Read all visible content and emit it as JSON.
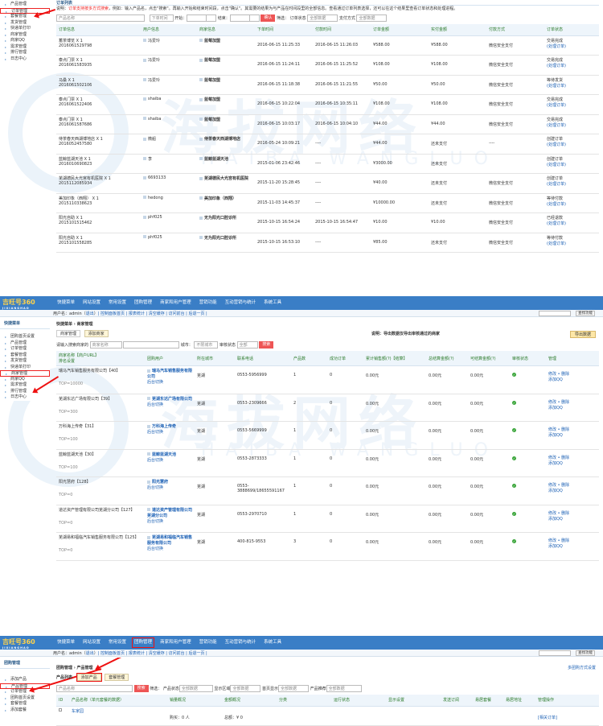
{
  "panel1": {
    "sidebar": [
      "产品管理",
      "订单管理",
      "套餐管理",
      "发货管理",
      "快递单打印",
      "商家管理",
      "商家QQ",
      "需求管理",
      "排行管理",
      "日志中心"
    ],
    "sidebar_selected": 1,
    "section_title": "订单列表",
    "notice_label": "说明：",
    "notice": "订单支持按多方式搜索",
    "notice_rest": "，例如：输入产品名，点击\"搜索\"。再输入开始和结束时间段，点击\"确认\"。其需要的结果为与产品在时间段里的全部信息。查看通过订单列表选择，还可以在这个结果里查看订单状态和处理进程。",
    "filter": {
      "product_placeholder": "产品名称",
      "order_time": "下单时间",
      "start": "开始：",
      "end": "结束：",
      "confirm": "确认",
      "filter_label": "筛选：",
      "status_label": "订单状态",
      "status_value": "全部数据",
      "pay_label": "支付方式",
      "pay_value": "全部数据"
    },
    "columns": [
      "订单信息",
      "用户信息",
      "商家信息",
      "下单时间",
      "付款时间",
      "订单金额",
      "实付金额",
      "付款方式",
      "订单状态"
    ],
    "rows": [
      {
        "product": "蓄茶博览 X 1",
        "no": "2016061529798",
        "user": "冯爱玲",
        "merchant": "蓝莓加盟",
        "time": "2016-06-15 11:25:33",
        "paid": "2016-06-15 11:26:03",
        "amount": "¥588.00",
        "actual": "¥588.00",
        "method": "微信安全支付",
        "status": "交易完成",
        "action": "(处理订单)"
      },
      {
        "product": "泰点门票 X 1",
        "no": "2016061583935",
        "user": "冯爱玲",
        "merchant": "蓝莓加盟",
        "time": "2016-06-15 11:24:11",
        "paid": "2016-06-15 11:25:52",
        "amount": "¥108.00",
        "actual": "¥108.00",
        "method": "微信安全支付",
        "status": "交易完成",
        "action": "(处理订单)"
      },
      {
        "product": "马桑 X 1",
        "no": "2016061502106",
        "user": "冯爱玲",
        "merchant": "蓝莓加盟",
        "time": "2016-06-15 11:18:38",
        "paid": "2016-06-15 11:21:55",
        "amount": "¥50.00",
        "actual": "¥50.00",
        "method": "微信安全支付",
        "status": "等待发货",
        "action": "(处理订单)"
      },
      {
        "product": "泰点门票 X 1",
        "no": "2016061522406",
        "user": "shaiba",
        "merchant": "蓝莓加盟",
        "time": "2016-06-15 10:22:04",
        "paid": "2016-06-15 10:35:11",
        "amount": "¥108.00",
        "actual": "¥108.00",
        "method": "微信安全支付",
        "status": "交易完成",
        "action": "(处理订单)"
      },
      {
        "product": "泰点门票 X 1",
        "no": "2016061587686",
        "user": "shaiba",
        "merchant": "蓝莓加盟",
        "time": "2016-06-15 10:03:17",
        "paid": "2016-06-15 10:04:10",
        "amount": "¥44.00",
        "actual": "¥44.00",
        "method": "微信安全支付",
        "status": "交易完成",
        "action": "(处理订单)"
      },
      {
        "product": "侍茶春天西湖博地店 X 1",
        "no": "2016052457580",
        "user": "微船",
        "merchant": "侍茶春天西湖博地店",
        "time": "2016-05-24 10:09:21",
        "paid": "----",
        "amount": "¥44.00",
        "actual": "还未支付",
        "method": "----",
        "status": "创建订单",
        "action": "(处理订单)"
      },
      {
        "product": "蓝鲸蓝湖天池 X 1",
        "no": "2016010690823",
        "user": "李",
        "merchant": "蓝鲸蓝湖天池",
        "time": "2015-01-06 23:42:46",
        "paid": "----",
        "amount": "¥3000.00",
        "actual": "还未支付",
        "method": "",
        "status": "创建订单",
        "action": "(处理订单)"
      },
      {
        "product": "芜湖德民大光宫有机医院 X 1",
        "no": "2015112085934",
        "user": "6693133",
        "merchant": "芜湖德民大光宫有机医院",
        "time": "2015-11-20 15:28:45",
        "paid": "----",
        "amount": "¥40.00",
        "actual": "还未支付",
        "method": "微信安全支付",
        "status": "创建订单",
        "action": "(处理订单)"
      },
      {
        "product": "美加印象（西翔） X 1",
        "no": "2015110338623",
        "user": "hedong",
        "merchant": "美加印象（西翔）",
        "time": "2015-11-03 14:45:37",
        "paid": "----",
        "amount": "¥10000.00",
        "actual": "还未支付",
        "method": "微信安全支付",
        "status": "等待付款",
        "action": "(处理订单)"
      },
      {
        "product": "阳光自助 X 1",
        "no": "2015101515462",
        "user": "phf025",
        "merchant": "无为阳光口腔诊所",
        "time": "2015-10-15 16:54:24",
        "paid": "2015-10-15 16:54:47",
        "amount": "¥10.00",
        "actual": "¥10.00",
        "method": "微信安全支付",
        "status": "已经退款",
        "action": "(处理订单)"
      },
      {
        "product": "阳光自助 X 1",
        "no": "2015101558285",
        "user": "phf025",
        "merchant": "无为阳光口腔诊所",
        "time": "2015-10-15 16:53:10",
        "paid": "----",
        "amount": "¥85.00",
        "actual": "还未支付",
        "method": "微信安全支付",
        "status": "等待付款",
        "action": "(处理订单)"
      }
    ]
  },
  "app": {
    "logo": "吉旺号360",
    "logo_sub": "JIXIANGHAO",
    "nav": [
      "快捷菜单",
      "网站设置",
      "常用设置",
      "团购管理",
      "商家和用户管理",
      "营销功能",
      "互动营销与统计",
      "系统工具"
    ],
    "user_line": "用户名：admin",
    "logout": "退出",
    "sub_links": "| 控制面板首页 | 报表统计 | 清空缓存 | 访问前台 | 后退一页 |",
    "search_btn": "查找功能"
  },
  "panel2": {
    "side_title": "快捷菜单",
    "sidebar": [
      "团购首页设置",
      "产品管理",
      "订单管理",
      "套餐管理",
      "发货管理",
      "快递单打印",
      "商家管理",
      "商家QQ",
      "需求管理",
      "排行管理",
      "日志中心"
    ],
    "sidebar_selected": 6,
    "breadcrumb": "快捷菜单 › 商家管理",
    "tab_mgr": "商家管理",
    "tab_add": "添加商家",
    "note": "说明：导出数据仅导出审核通过的商家",
    "export": "导出数据",
    "kw_label": "请输入搜索商家的",
    "kw_placeholder": "商家名称",
    "city_label": "城市：",
    "city_value": "不限城市",
    "audit_label": "审核状态",
    "audit_value": "全部",
    "search": "搜索",
    "columns": [
      "商家名称【商户URL】\n排名设置",
      "团购用户",
      "所在城市",
      "联系电话",
      "产品数",
      "成功订单",
      "累计销售额(?)【结算】",
      "总结算金额(?)",
      "可结算金额(?)",
      "审核状态",
      "管理"
    ],
    "rows": [
      {
        "name": "瑞马汽车销售服务有限公司【40】",
        "top": "TOP=10000",
        "user": "瑞马汽车销售服务有限公司",
        "user_link": "后台切换",
        "city": "芜湖",
        "phone": "0553-5956999",
        "products": "1",
        "orders": "0",
        "sales": "0.00元",
        "total": "0.00元",
        "avail": "0.00元",
        "manage": "修改 • 删除",
        "qq": "添加QQ"
      },
      {
        "name": "芜湖东达广场有限公司【39】",
        "top": "TOP=300",
        "user": "芜湖东达广场有限公司",
        "user_link": "后台切换",
        "city": "芜湖",
        "phone": "0553-2309666",
        "products": "2",
        "orders": "0",
        "sales": "0.00元",
        "total": "0.00元",
        "avail": "0.00元",
        "manage": "修改 • 删除",
        "qq": "添加QQ"
      },
      {
        "name": "万科海上传奇【31】",
        "top": "TOP=100",
        "user": "万科海上传奇",
        "user_link": "后台切换",
        "city": "芜湖",
        "phone": "0553-5669999",
        "products": "1",
        "orders": "0",
        "sales": "0.00元",
        "total": "0.00元",
        "avail": "0.00元",
        "manage": "修改 • 删除",
        "qq": "添加QQ"
      },
      {
        "name": "蓝鲸蓝湖天池【30】",
        "top": "TOP=100",
        "user": "蓝鲸蓝湖天池",
        "user_link": "后台切换",
        "city": "芜湖",
        "phone": "0553-2873333",
        "products": "1",
        "orders": "0",
        "sales": "0.00元",
        "total": "0.00元",
        "avail": "0.00元",
        "manage": "修改 • 删除",
        "qq": "添加QQ"
      },
      {
        "name": "阳光慧府【128】",
        "top": "TOP=0",
        "user": "阳光慧府",
        "user_link": "后台切换",
        "city": "芜湖",
        "phone": "0553-3888699/18655591167",
        "products": "1",
        "orders": "0",
        "sales": "0.00元",
        "total": "0.00元",
        "avail": "0.00元",
        "manage": "修改 • 删除",
        "qq": "添加QQ"
      },
      {
        "name": "道达资产管理有限公司芜湖分公司【127】",
        "top": "TOP=0",
        "user": "道达资产管理有限公司芜湖分公司",
        "user_link": "后台切换",
        "city": "芜湖",
        "phone": "0553-2970710",
        "products": "1",
        "orders": "0",
        "sales": "0.00元",
        "total": "0.00元",
        "avail": "0.00元",
        "manage": "修改 • 删除",
        "qq": "添加QQ"
      },
      {
        "name": "芜湖易和福临汽车销售服务有限公司【125】",
        "top": "TOP=0",
        "user": "芜湖易和福临汽车销售服务有限公司",
        "user_link": "后台切换",
        "city": "芜湖",
        "phone": "400-815-9553",
        "products": "3",
        "orders": "0",
        "sales": "0.00元",
        "total": "0.00元",
        "avail": "0.00元",
        "manage": "修改 • 删除",
        "qq": "添加QQ"
      }
    ]
  },
  "panel3": {
    "side_title": "团购管理",
    "sidebar": [
      "添加产品",
      "产品管理",
      "订单管理",
      "团购首页设置",
      "套餐管理",
      "添加套餐"
    ],
    "sidebar_selected": 1,
    "breadcrumb": "团购管理 › 产品管理",
    "right_link": "多团购方式设置",
    "tab_list": "产品列表",
    "tab_add": "添加产品",
    "tab_pkg": "套餐管理",
    "search_placeholder": "产品名称",
    "search": "搜索",
    "filter_label": "筛选：",
    "f1": "产品状态",
    "f1v": "全部数据",
    "f2": "显示区域",
    "f2v": "全部数据",
    "f3": "首页显示",
    "f3v": "全部数据",
    "f4": "产品推荐",
    "f4v": "全部数据",
    "columns": [
      "ID",
      "产品名称（单元套餐的数据）",
      "销量概况",
      "金额概况",
      "分类",
      "运行状态",
      "显示设置",
      "发送订阅",
      "易居套餐",
      "易居地址",
      "管理操作"
    ],
    "row": {
      "name": "车家园",
      "sales": "购买：0 人",
      "money": "总额：¥ 0",
      "op": "[相关订单]"
    }
  },
  "watermark": {
    "text": "海拔网络",
    "sub": "HAIBA WANGLUO"
  }
}
